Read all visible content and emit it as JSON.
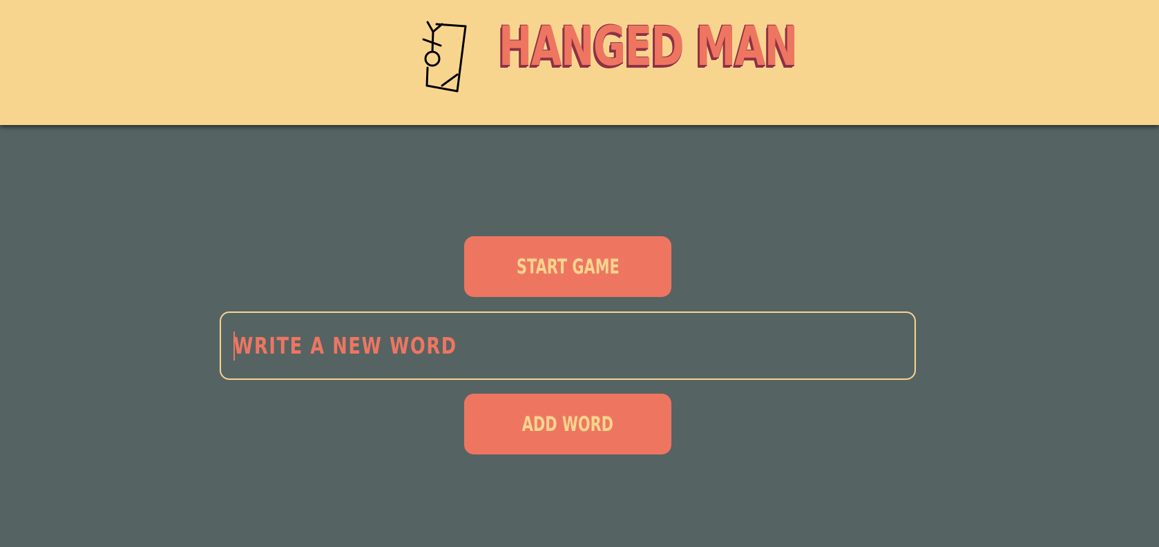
{
  "header": {
    "title": "HANGED MAN",
    "logo_icon": "hanged-man-gallows-icon"
  },
  "main": {
    "start_button_label": "START GAME",
    "word_input": {
      "value": "",
      "placeholder": "WRITE A NEW WORD"
    },
    "add_button_label": "ADD WORD"
  },
  "colors": {
    "header_bg": "#F8D58F",
    "page_bg": "#566363",
    "accent": "#EE7661",
    "title_shadow": "#8E3046"
  }
}
